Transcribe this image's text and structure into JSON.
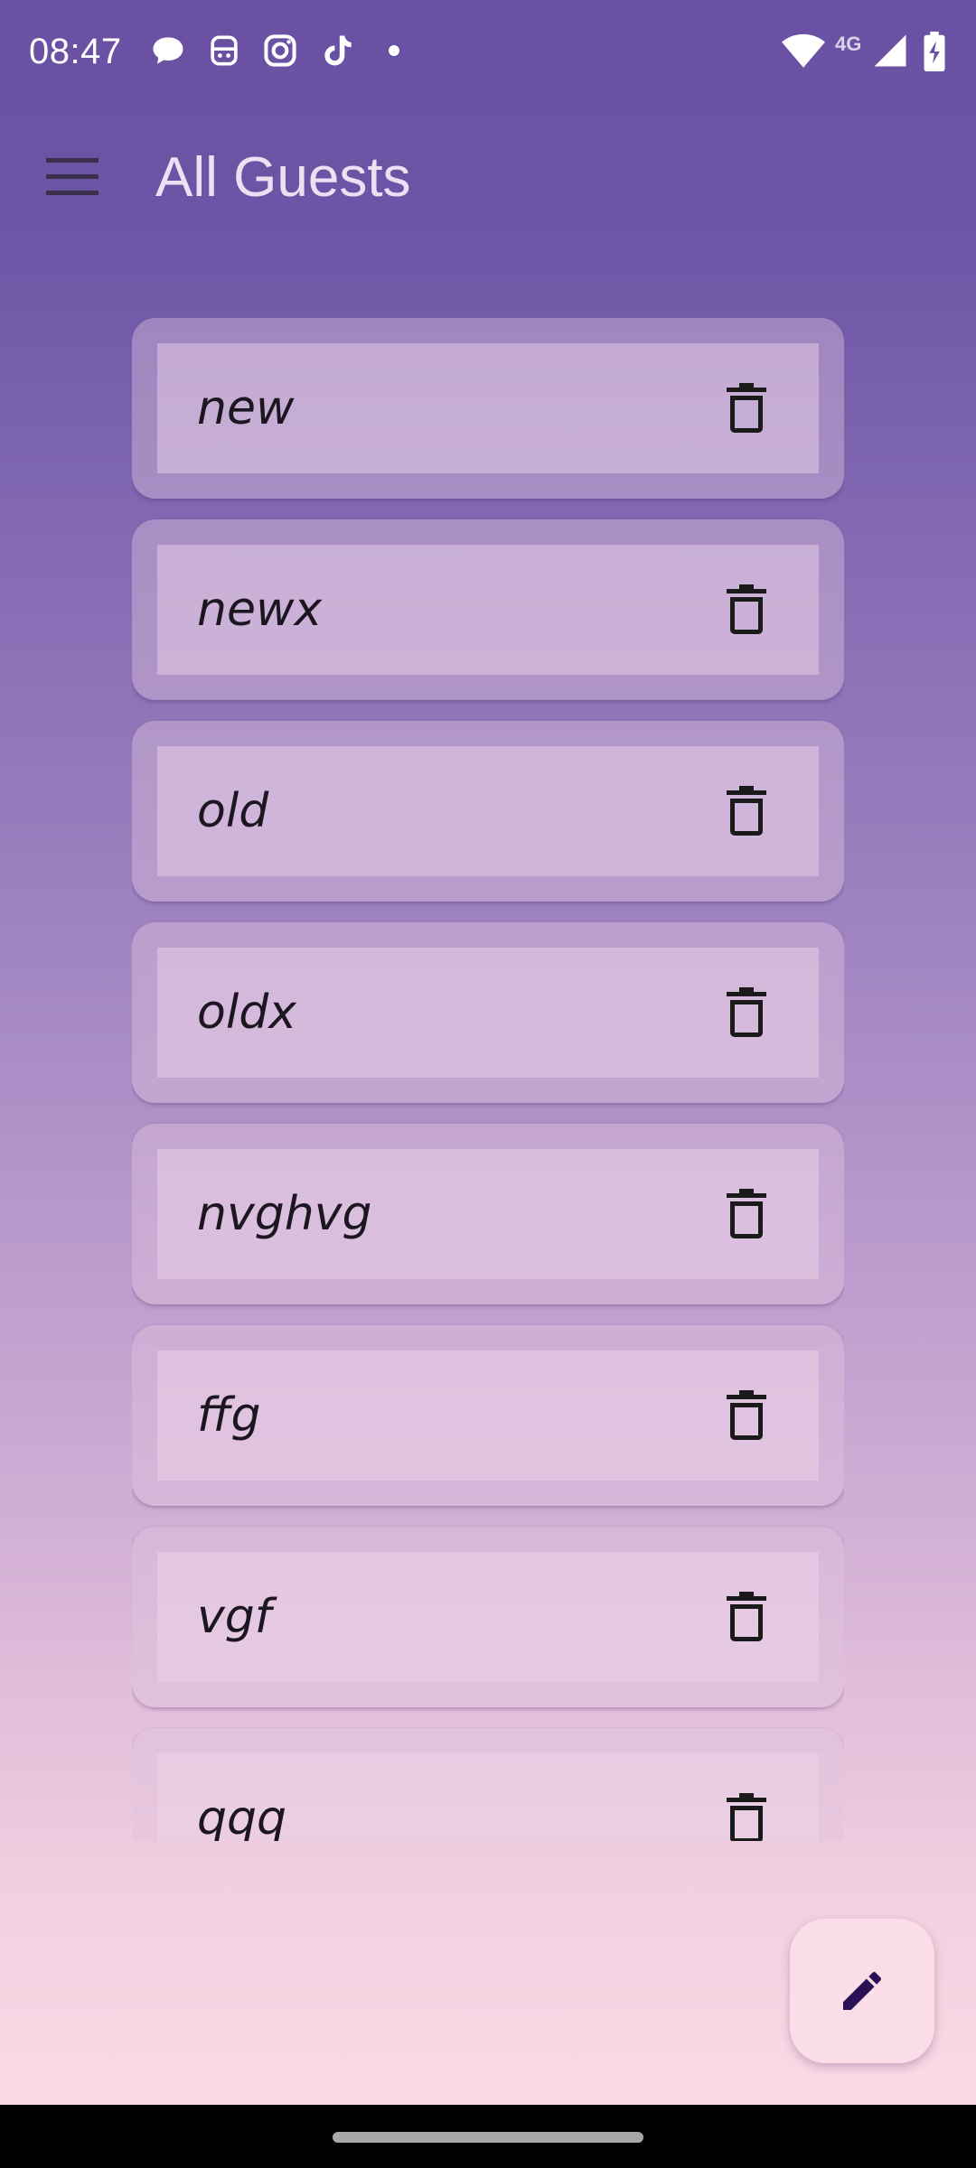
{
  "status_bar": {
    "time": "08:47",
    "network_label": "4G",
    "icons": [
      "chat-bubble-icon",
      "assistant-icon",
      "instagram-icon",
      "tiktok-icon",
      "notification-dot",
      "wifi-icon",
      "signal-icon",
      "battery-charging-icon"
    ]
  },
  "app_bar": {
    "menu_icon": "hamburger-menu-icon",
    "title": "All Guests"
  },
  "guests": [
    {
      "name": "new"
    },
    {
      "name": "newx"
    },
    {
      "name": "old"
    },
    {
      "name": "oldx"
    },
    {
      "name": "nvghvg"
    },
    {
      "name": "ffg"
    },
    {
      "name": "vgf"
    },
    {
      "name": "qqq"
    }
  ],
  "row_action_icon": "trash-icon",
  "fab": {
    "icon": "edit-pencil-icon"
  },
  "colors": {
    "top_gradient": "#6950a3",
    "bottom_gradient": "#fbd9e5",
    "fab_background": "#fbdde7",
    "fab_icon": "#2a1155"
  }
}
